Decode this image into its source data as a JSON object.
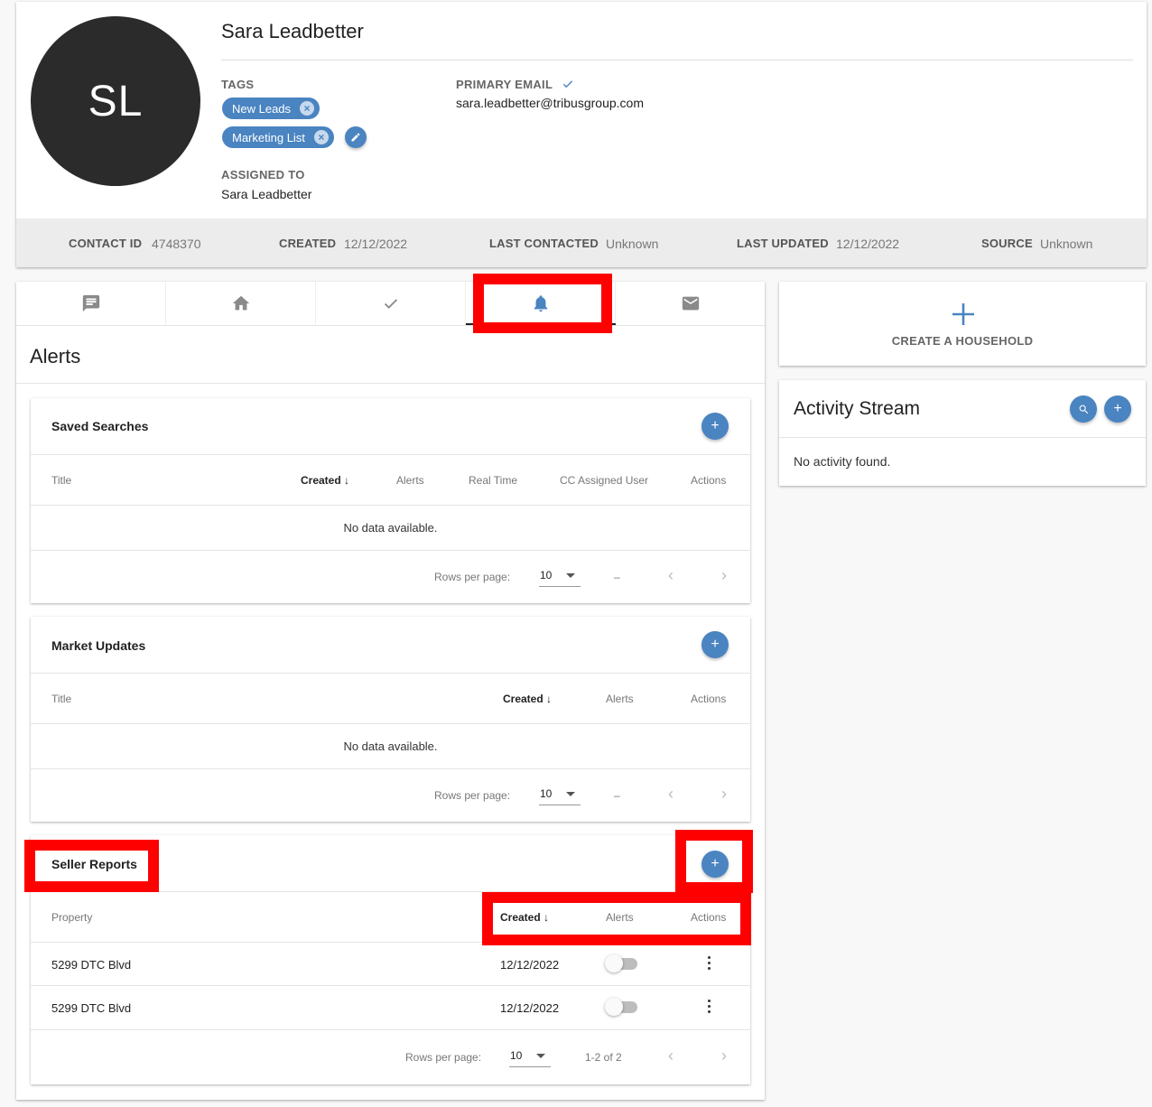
{
  "contact": {
    "initials": "SL",
    "name": "Sara Leadbetter",
    "tags_label": "TAGS",
    "tags": [
      "New Leads",
      "Marketing List"
    ],
    "primary_email_label": "PRIMARY EMAIL",
    "primary_email": "sara.leadbetter@tribusgroup.com",
    "assigned_to_label": "ASSIGNED TO",
    "assigned_to": "Sara Leadbetter"
  },
  "info_bar": {
    "contact_id_label": "CONTACT ID",
    "contact_id": "4748370",
    "created_label": "CREATED",
    "created": "12/12/2022",
    "last_contacted_label": "LAST CONTACTED",
    "last_contacted": "Unknown",
    "last_updated_label": "LAST UPDATED",
    "last_updated": "12/12/2022",
    "source_label": "SOURCE",
    "source": "Unknown"
  },
  "tabs": [
    {
      "icon": "notes-icon",
      "active": false
    },
    {
      "icon": "home-icon",
      "active": false
    },
    {
      "icon": "check-icon",
      "active": false
    },
    {
      "icon": "bell-icon",
      "active": true
    },
    {
      "icon": "mail-icon",
      "active": false
    }
  ],
  "section_title": "Alerts",
  "saved_searches": {
    "title": "Saved Searches",
    "columns": [
      "Title",
      "Created",
      "Alerts",
      "Real Time",
      "CC Assigned User",
      "Actions"
    ],
    "empty": "No data available.",
    "rows_per_page_label": "Rows per page:",
    "rows_per_page": "10",
    "range": "–"
  },
  "market_updates": {
    "title": "Market Updates",
    "columns": [
      "Title",
      "Created",
      "Alerts",
      "Actions"
    ],
    "empty": "No data available.",
    "rows_per_page_label": "Rows per page:",
    "rows_per_page": "10",
    "range": "–"
  },
  "seller_reports": {
    "title": "Seller Reports",
    "columns": [
      "Property",
      "Created",
      "Alerts",
      "Actions"
    ],
    "rows": [
      {
        "property": "5299 DTC Blvd",
        "created": "12/12/2022",
        "alerts": false
      },
      {
        "property": "5299 DTC Blvd",
        "created": "12/12/2022",
        "alerts": false
      }
    ],
    "rows_per_page_label": "Rows per page:",
    "rows_per_page": "10",
    "range": "1-2 of 2"
  },
  "household": {
    "label": "CREATE A HOUSEHOLD"
  },
  "activity": {
    "title": "Activity Stream",
    "empty": "No activity found."
  },
  "colors": {
    "accent": "#4a84c1",
    "annotation": "#ff0000"
  }
}
